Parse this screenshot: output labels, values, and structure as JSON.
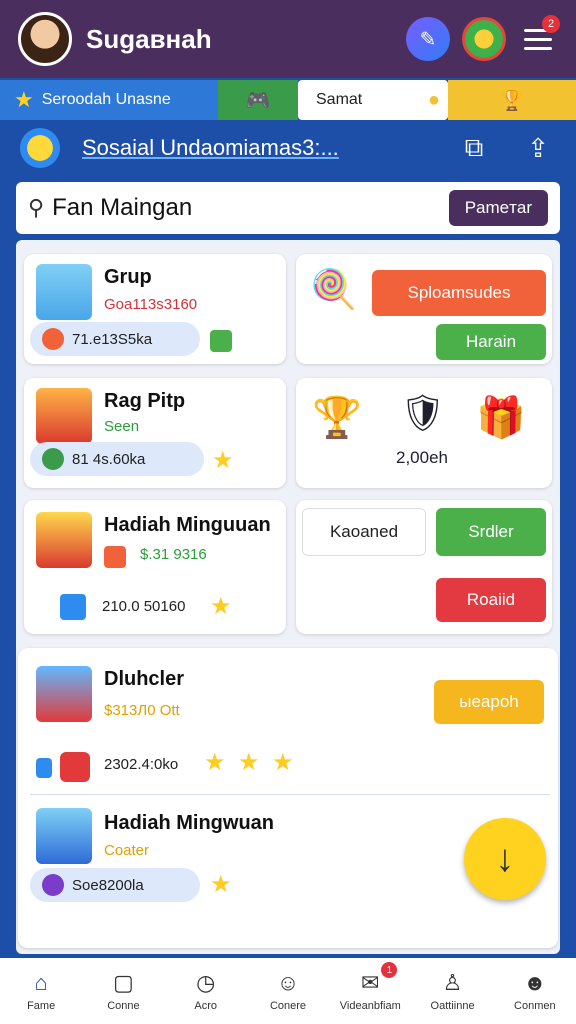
{
  "header": {
    "app_title": "Sugaвнah",
    "notif_count": "2"
  },
  "strip": {
    "label_a": "Seroodah Unasne",
    "label_c": "Samat"
  },
  "subheader": {
    "title": "Sosaial Undaomiamas3:..."
  },
  "search": {
    "query": "Fan Maingan",
    "button_label": "Pameтar"
  },
  "cards": [
    {
      "title": "Grup",
      "sub": "Goa113s3160",
      "pill": "71.e13Ѕ5ka"
    },
    {
      "title": "Rag Pitp",
      "sub": "Seen",
      "pill": "81 4ѕ.60ka"
    },
    {
      "title": "Hadiah Minguuan",
      "sub": "$.31 9316",
      "pill": "210.0 50160"
    },
    {
      "title": "Dluhcler",
      "sub": "$313Л0 Ott",
      "pill": "2302.4:0ko"
    },
    {
      "title": "Hadiah Mingwuan",
      "sub": "Coater",
      "pill": "Soe8200la"
    }
  ],
  "side": {
    "orange_btn": "Sploаmsudes",
    "green_btn": "Harain",
    "icons_value": "2,00eh",
    "white_btn": "Kaoaned",
    "green_btn2": "Srdler",
    "red_btn": "Roaiid",
    "yellow_btn": "ыeapoh"
  },
  "nav": [
    {
      "label": "Fame",
      "icon": "home-icon"
    },
    {
      "label": "Conne",
      "icon": "chart-icon"
    },
    {
      "label": "Acro",
      "icon": "clock-icon"
    },
    {
      "label": "Conere",
      "icon": "face-icon"
    },
    {
      "label": "Videanbfiam",
      "icon": "message-icon",
      "badge": "1"
    },
    {
      "label": "Oattiinne",
      "icon": "user-icon"
    },
    {
      "label": "Conmen",
      "icon": "profile-icon"
    }
  ],
  "colors": {
    "header_bg": "#4a2f5e",
    "page_bg": "#1d4fa8",
    "accent_yellow": "#ffd21f"
  }
}
